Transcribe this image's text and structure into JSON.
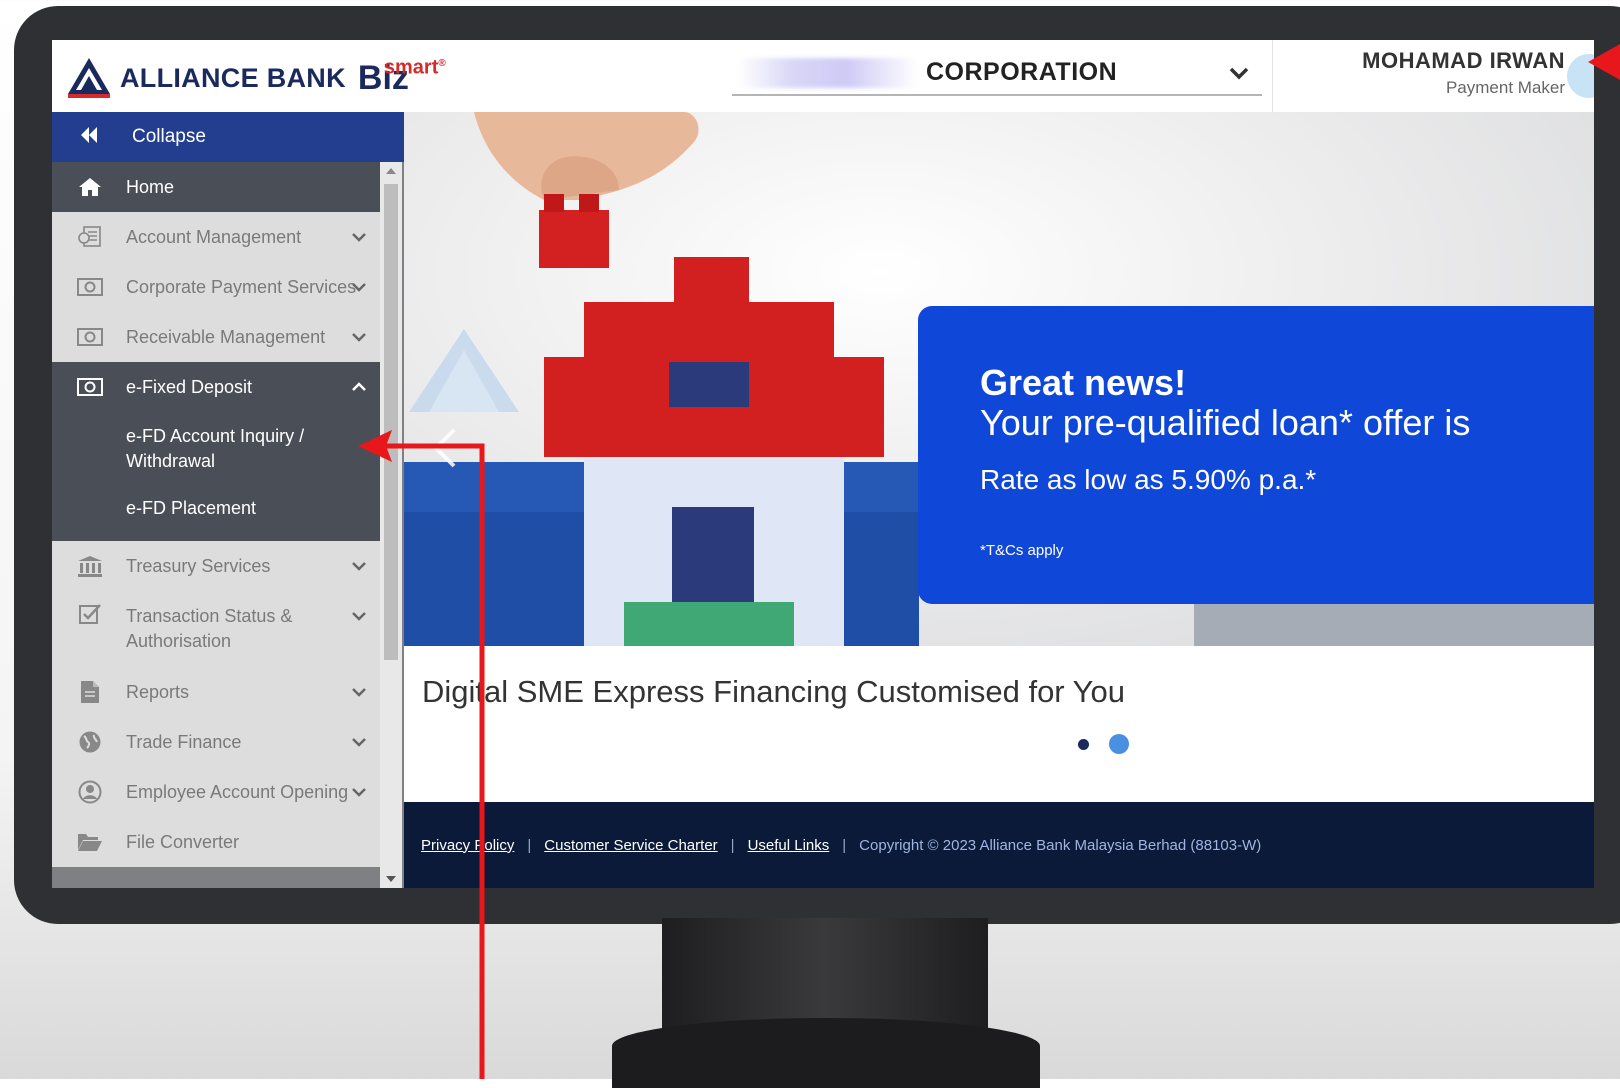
{
  "brand": {
    "name": "ALLIANCE BANK",
    "product": "Biz",
    "product_suffix": "smart",
    "registered": "®"
  },
  "header": {
    "corporation": "CORPORATION",
    "user_name": "MOHAMAD IRWAN",
    "user_role": "Payment Maker"
  },
  "sidebar": {
    "collapse_label": "Collapse",
    "items": [
      {
        "label": "Home",
        "icon": "home-icon"
      },
      {
        "label": "Account Management",
        "icon": "ledger-icon"
      },
      {
        "label": "Corporate Payment Services",
        "icon": "money-icon"
      },
      {
        "label": "Receivable Management",
        "icon": "money-icon"
      },
      {
        "label": "e-Fixed Deposit",
        "icon": "money-icon",
        "expanded": true,
        "children": [
          {
            "label": "e-FD Account Inquiry / Withdrawal"
          },
          {
            "label": "e-FD Placement"
          }
        ]
      },
      {
        "label": "Treasury Services",
        "icon": "bank-icon"
      },
      {
        "label": "Transaction Status & Authorisation",
        "icon": "checkbox-icon"
      },
      {
        "label": "Reports",
        "icon": "document-icon"
      },
      {
        "label": "Trade Finance",
        "icon": "globe-icon"
      },
      {
        "label": "Employee Account Opening",
        "icon": "user-icon"
      },
      {
        "label": "File Converter",
        "icon": "folder-icon"
      }
    ]
  },
  "banner": {
    "headline": "Great news!",
    "subheadline": "Your pre-qualified loan* offer is",
    "rate": "Rate as low as 5.90% p.a.*",
    "terms": "*T&Cs apply",
    "caption": "Digital SME Express Financing Customised for You",
    "slides": 2,
    "active_slide": 2
  },
  "footer": {
    "links": [
      "Privacy Policy",
      "Customer Service Charter",
      "Useful Links"
    ],
    "copyright": "Copyright © 2023 Alliance Bank Malaysia Berhad (88103-W)"
  },
  "colors": {
    "navy": "#1b2a5c",
    "collapse_bar": "#233e8f",
    "menu_dark": "#4a4e57",
    "promo_blue": "#0f47d9",
    "footer_bg": "#0b1a38",
    "annotation_red": "#e8171b"
  }
}
